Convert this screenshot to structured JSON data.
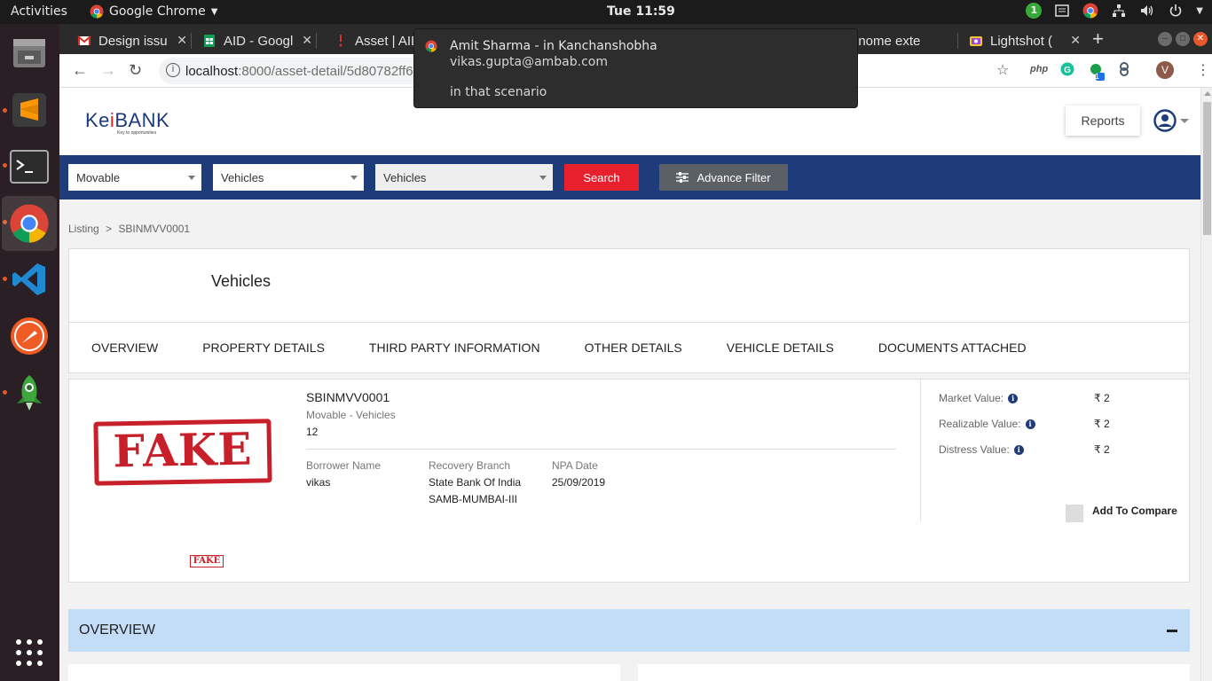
{
  "system": {
    "activities": "Activities",
    "app_name": "Google Chrome",
    "clock": "Tue 11:59",
    "tray_badge": "1"
  },
  "browser": {
    "tabs": [
      {
        "label": "Design issu"
      },
      {
        "label": "AID - Googl"
      },
      {
        "label": "Asset | AID"
      },
      {
        "label": "gnome exte"
      },
      {
        "label": "Lightshot ("
      }
    ],
    "url_host": "localhost",
    "url_path": ":8000/asset-detail/5d80782ff60",
    "ext_php": "php",
    "ext_badge": "1",
    "profile_initial": "V"
  },
  "notification": {
    "title": "Amit Sharma - in Kanchanshobha",
    "subtitle": "vikas.gupta@ambab.com",
    "body": "in that scenario"
  },
  "header": {
    "logo_prefix": "Ke",
    "logo_i": "i",
    "logo_suffix": "BANK",
    "logo_tagline": "Key to opportunities",
    "reports_label": "Reports"
  },
  "filters": {
    "category": "Movable",
    "subcategory": "Vehicles",
    "type": "Vehicles",
    "search_label": "Search",
    "advance_label": "Advance Filter"
  },
  "breadcrumb": {
    "root": "Listing",
    "sep": ">",
    "current": "SBINMVV0001"
  },
  "title_card": {
    "title": "Vehicles",
    "tabs": [
      "OVERVIEW",
      "PROPERTY DETAILS",
      "THIRD PARTY INFORMATION",
      "OTHER DETAILS",
      "VEHICLE DETAILS",
      "DOCUMENTS ATTACHED"
    ]
  },
  "asset": {
    "stamp_text": "FAKE",
    "id": "SBINMVV0001",
    "type": "Movable - Vehicles",
    "number": "12",
    "borrower_label": "Borrower Name",
    "borrower": "vikas",
    "branch_label": "Recovery Branch",
    "branch_line1": "State Bank Of India",
    "branch_line2": "SAMB-MUMBAI-III",
    "npa_label": "NPA Date",
    "npa_date": "25/09/2019",
    "values": [
      {
        "label": "Market Value:",
        "amount": "₹ 2"
      },
      {
        "label": "Realizable Value:",
        "amount": "₹ 2"
      },
      {
        "label": "Distress Value:",
        "amount": "₹ 2"
      }
    ],
    "compare_label": "Add To Compare"
  },
  "overview": {
    "label": "OVERVIEW"
  },
  "colors": {
    "navy": "#1e3c7a",
    "red": "#e8202e",
    "overview_bg": "#c3ddf9"
  }
}
